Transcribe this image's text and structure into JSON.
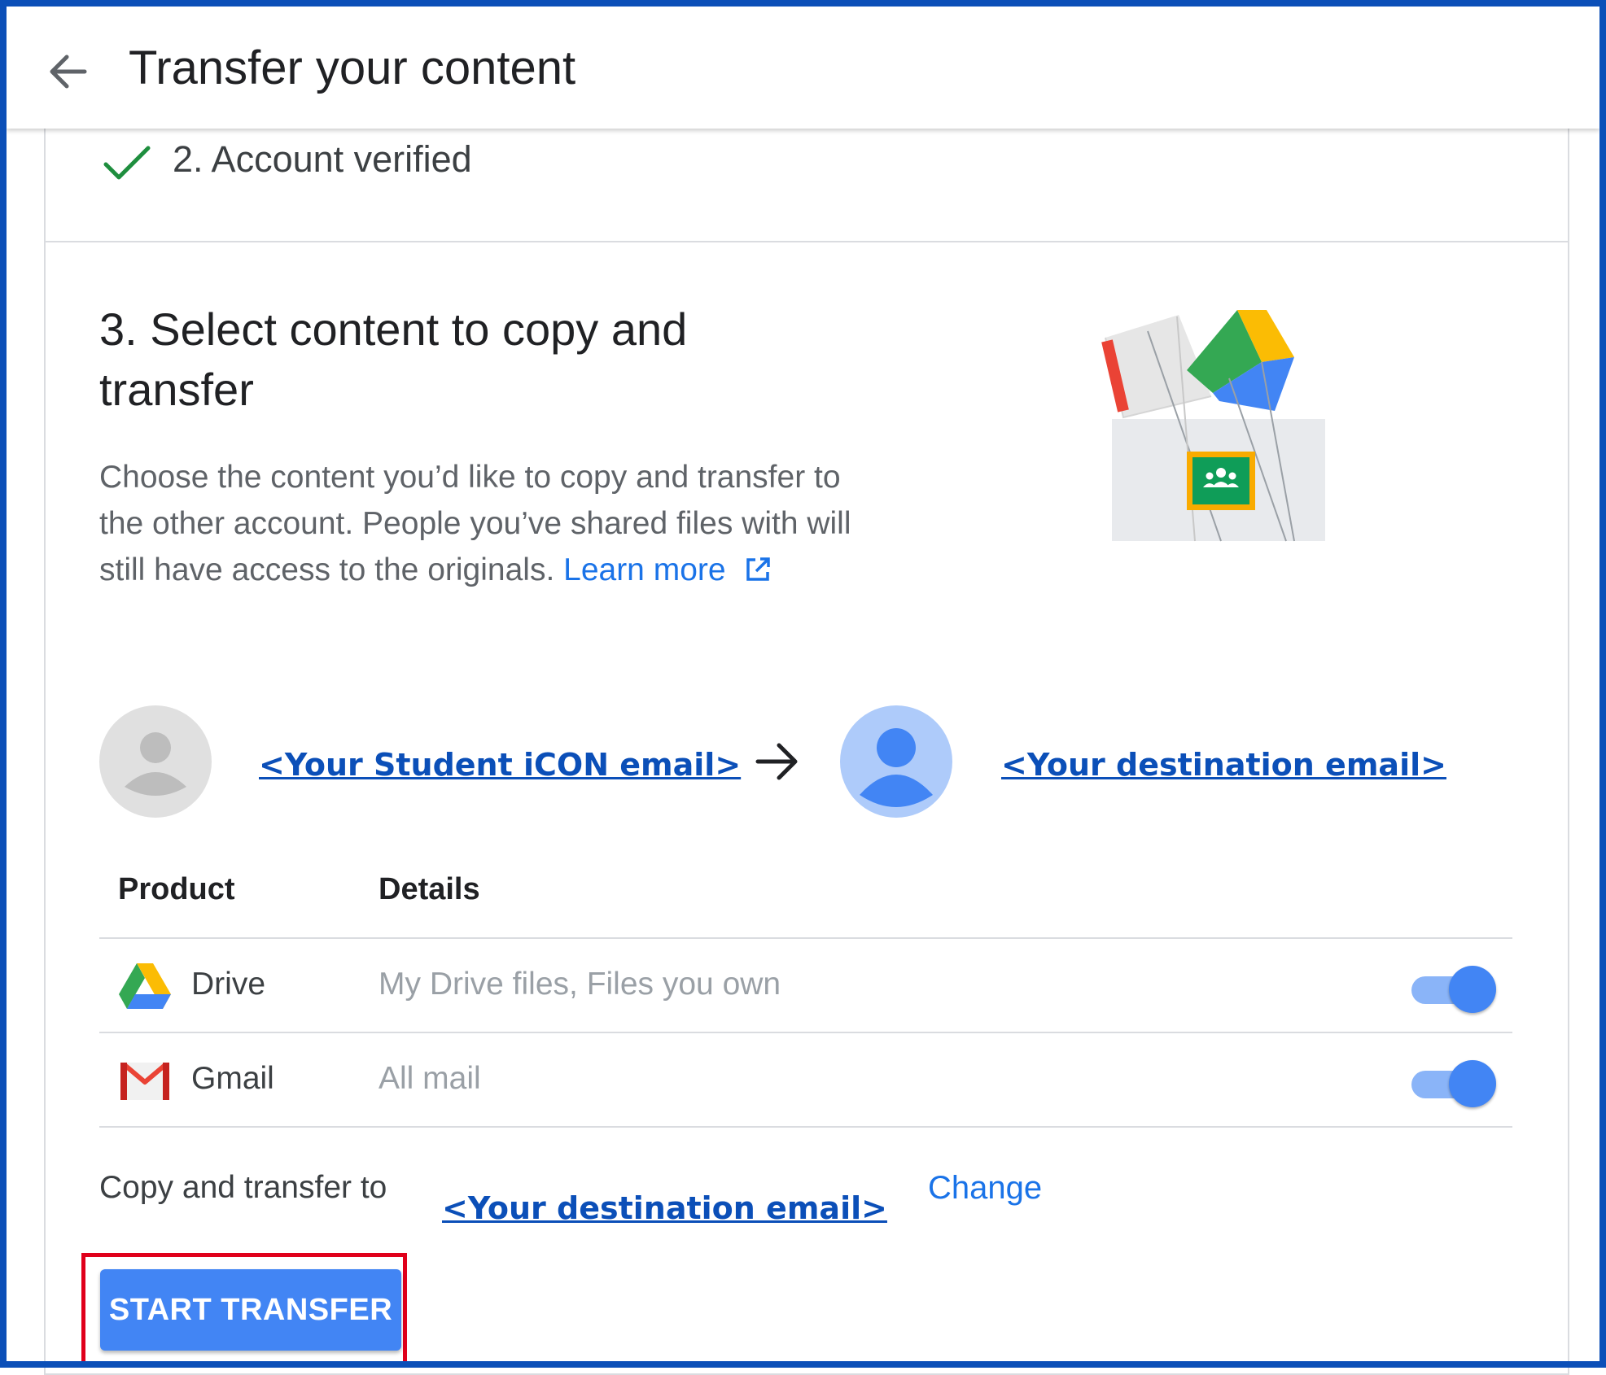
{
  "header": {
    "back_icon": "arrow-left-icon",
    "title": "Transfer your content"
  },
  "step2": {
    "icon": "check-icon",
    "label": "2. Account verified",
    "check_color": "#1e8e3e"
  },
  "step3": {
    "title": "3. Select content to copy and transfer",
    "description": "Choose the content you’d like to copy and transfer to the other account. People you’ve shared files with will still have access to the originals.",
    "learn_more": "Learn more",
    "external_icon": "open-in-new-icon"
  },
  "accounts": {
    "source_email": "<Your Student iCON email>",
    "destination_email": "<Your destination email>",
    "source_avatar_icon": "person-avatar-icon",
    "destination_avatar_icon": "person-avatar-icon",
    "arrow_icon": "arrow-right-icon"
  },
  "table": {
    "headers": {
      "product": "Product",
      "details": "Details"
    },
    "rows": [
      {
        "product": "Drive",
        "details": "My Drive files, Files you own",
        "icon": "google-drive-icon",
        "enabled": true
      },
      {
        "product": "Gmail",
        "details": "All mail",
        "icon": "gmail-icon",
        "enabled": true
      }
    ]
  },
  "footer": {
    "copy_label": "Copy and transfer to",
    "destination_email": "<Your destination email>",
    "change_label": "Change",
    "start_button": "START TRANSFER"
  },
  "colors": {
    "accent": "#4285f4",
    "link": "#1a73e8",
    "annotation_blue": "#0b4fb8",
    "highlight_red": "#e0001b"
  }
}
